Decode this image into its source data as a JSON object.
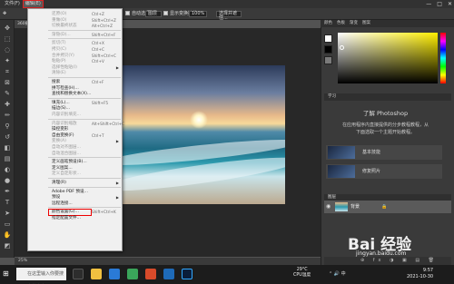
{
  "menubar": {
    "items": [
      "文件(F)",
      "编辑(E)"
    ],
    "window_controls": [
      "—",
      "□",
      "✕"
    ]
  },
  "options": {
    "prefix": "取样大小:",
    "auto_select": "自动选择",
    "layer": "图层",
    "show_transform": "显示变换控件",
    "opacity_value": "100%",
    "refine": "选择并遮住..."
  },
  "doc_tab": "360截图2021...",
  "status_bar": "25%",
  "edit_menu": [
    {
      "label": "还原(O)",
      "shortcut": "Ctrl+Z",
      "disabled": true
    },
    {
      "label": "重做(O)",
      "shortcut": "Shift+Ctrl+Z",
      "disabled": true
    },
    {
      "label": "切换最终状态",
      "shortcut": "Alt+Ctrl+Z",
      "disabled": true
    },
    {
      "sep": true
    },
    {
      "label": "渐隐(D)...",
      "shortcut": "Shift+Ctrl+F",
      "disabled": true
    },
    {
      "sep": true
    },
    {
      "label": "剪切(T)",
      "shortcut": "Ctrl+X",
      "disabled": true
    },
    {
      "label": "拷贝(C)",
      "shortcut": "Ctrl+C",
      "disabled": true
    },
    {
      "label": "合并拷贝(Y)",
      "shortcut": "Shift+Ctrl+C",
      "disabled": true
    },
    {
      "label": "粘贴(P)",
      "shortcut": "Ctrl+V",
      "disabled": true
    },
    {
      "label": "选择性粘贴(I)",
      "shortcut": "",
      "disabled": true,
      "submenu": true
    },
    {
      "label": "清除(E)",
      "shortcut": "",
      "disabled": true
    },
    {
      "sep": true
    },
    {
      "label": "搜索",
      "shortcut": "Ctrl+F",
      "disabled": false
    },
    {
      "label": "拼写检查(H)...",
      "shortcut": "",
      "disabled": false
    },
    {
      "label": "查找和替换文本(X)...",
      "shortcut": "",
      "disabled": false
    },
    {
      "sep": true
    },
    {
      "label": "填充(L)...",
      "shortcut": "Shift+F5",
      "disabled": false
    },
    {
      "label": "描边(S)...",
      "shortcut": "",
      "disabled": false
    },
    {
      "label": "内容识别填充...",
      "shortcut": "",
      "disabled": true
    },
    {
      "sep": true
    },
    {
      "label": "内容识别缩放",
      "shortcut": "Alt+Shift+Ctrl+C",
      "disabled": true
    },
    {
      "label": "操控变形",
      "shortcut": "",
      "disabled": false
    },
    {
      "label": "自由变换(F)",
      "shortcut": "Ctrl+T",
      "disabled": false
    },
    {
      "label": "变换(A)",
      "shortcut": "",
      "disabled": true,
      "submenu": true
    },
    {
      "label": "自动对齐图层...",
      "shortcut": "",
      "disabled": true
    },
    {
      "label": "自动混合图层...",
      "shortcut": "",
      "disabled": true
    },
    {
      "sep": true
    },
    {
      "label": "定义画笔预设(B)...",
      "shortcut": "",
      "disabled": false
    },
    {
      "label": "定义图案...",
      "shortcut": "",
      "disabled": false
    },
    {
      "label": "定义自定形状...",
      "shortcut": "",
      "disabled": true
    },
    {
      "sep": true
    },
    {
      "label": "清理(R)",
      "shortcut": "",
      "disabled": false,
      "submenu": true
    },
    {
      "sep": true
    },
    {
      "label": "Adobe PDF 预设...",
      "shortcut": "",
      "disabled": false
    },
    {
      "label": "预设",
      "shortcut": "",
      "disabled": false,
      "submenu": true
    },
    {
      "label": "远程连接...",
      "shortcut": "",
      "disabled": false
    },
    {
      "sep": true
    },
    {
      "label": "颜色设置(G)...",
      "shortcut": "Shift+Ctrl+K",
      "disabled": false,
      "highlight": true
    },
    {
      "label": "指定配置文件...",
      "shortcut": "",
      "disabled": false
    }
  ],
  "panels": {
    "tabs": [
      "颜色",
      "色板",
      "渐变",
      "图案"
    ],
    "learn_header": "学习",
    "learn_title": "了解 Photoshop",
    "learn_desc_1": "在应用程序内直接提供的分步教程教程，从",
    "learn_desc_2": "下面选取一个主题开始教程。",
    "learn_items": [
      "基本技能",
      "修复照片"
    ],
    "layers_header": "图层",
    "layer_name": "背景",
    "layer_lock": "🔒",
    "swatch_colors": [
      "#ffffff",
      "#000000",
      "#7a7a7a"
    ],
    "accent_color": "#ffef00"
  },
  "taskbar": {
    "search_placeholder": "在这里输入你要搜索的内容",
    "temp": "29°C",
    "temp_label": "CPU温度",
    "system_text": "⌃ 🔊 中",
    "time": "9:57",
    "date": "2021-10-30"
  },
  "watermark": {
    "logo": "Bai 经验",
    "url": "jingyan.baidu.com"
  }
}
